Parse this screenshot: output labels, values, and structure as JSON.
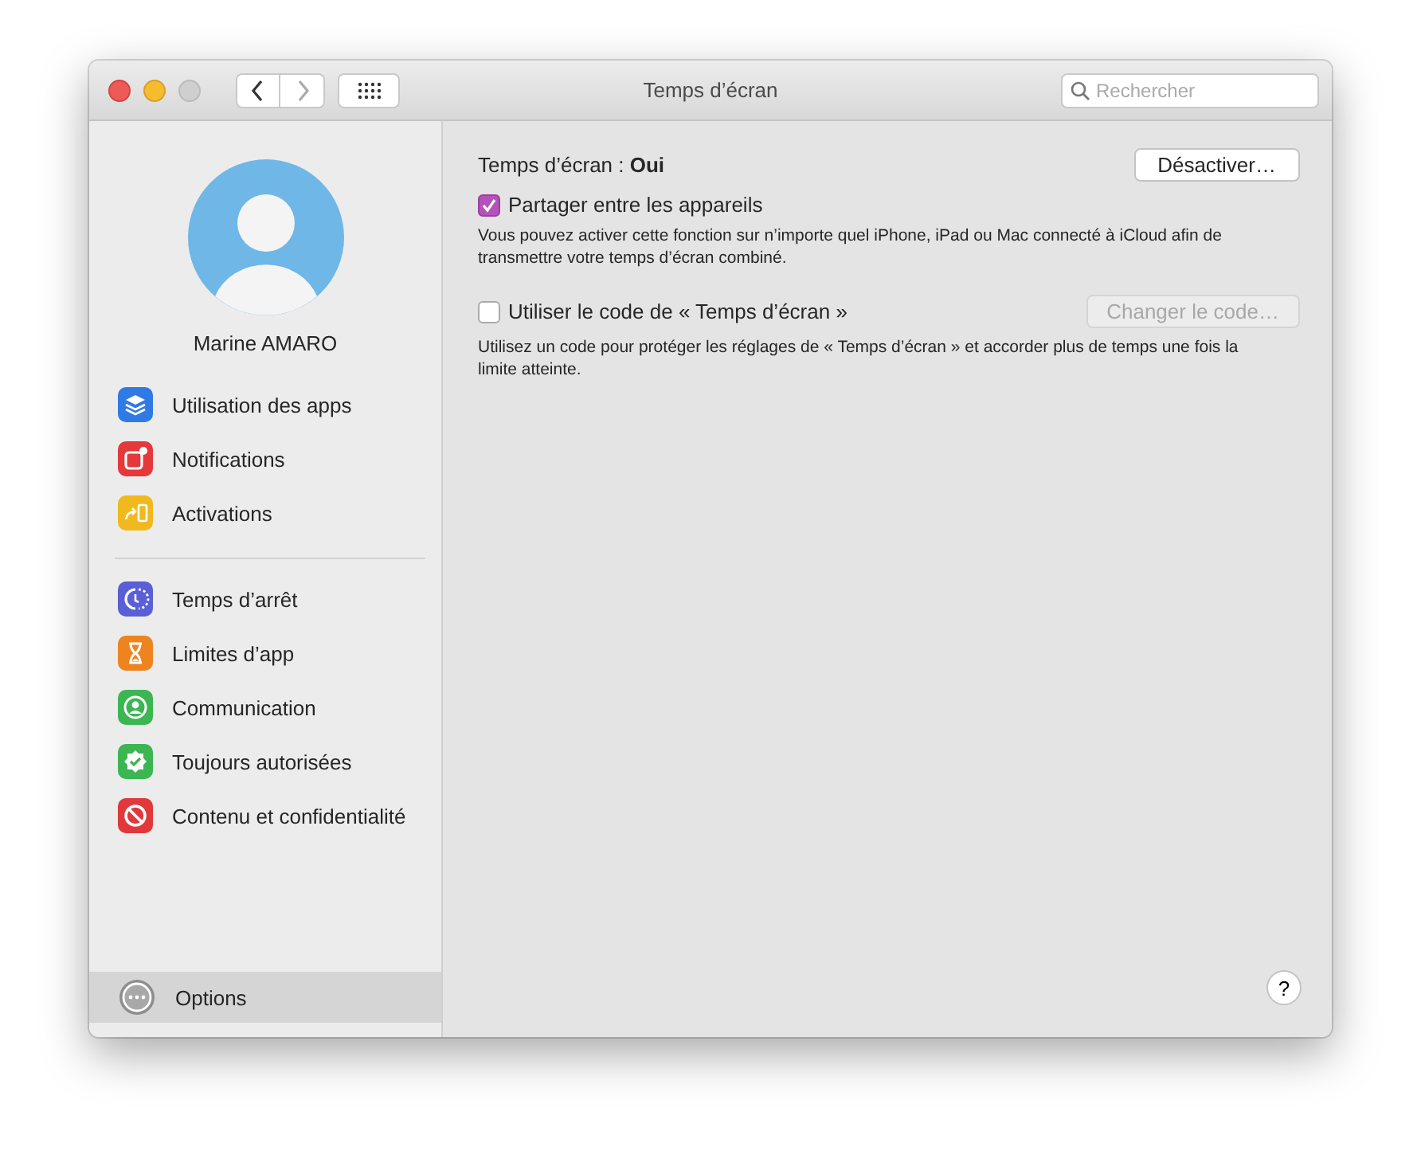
{
  "window": {
    "title": "Temps d’écran"
  },
  "search": {
    "placeholder": "Rechercher"
  },
  "user": {
    "name": "Marine AMARO"
  },
  "sidebar": {
    "groups": [
      {
        "items": [
          {
            "label": "Utilisation des apps",
            "kind": "layers",
            "color": "#2f7ae5",
            "selected": false
          },
          {
            "label": "Notifications",
            "kind": "notification",
            "color": "#e5383b",
            "selected": false
          },
          {
            "label": "Activations",
            "kind": "pickup",
            "color": "#f0b91e",
            "selected": false
          }
        ]
      },
      {
        "items": [
          {
            "label": "Temps d’arrêt",
            "kind": "downtime",
            "color": "#5a5fd6",
            "selected": false
          },
          {
            "label": "Limites d’app",
            "kind": "hourglass",
            "color": "#ee8420",
            "selected": false
          },
          {
            "label": "Communication",
            "kind": "person",
            "color": "#3cb653",
            "selected": false
          },
          {
            "label": "Toujours autorisées",
            "kind": "check",
            "color": "#3cb653",
            "selected": false
          },
          {
            "label": "Contenu et confidentialité",
            "kind": "block",
            "color": "#e0383b",
            "selected": false
          }
        ]
      }
    ],
    "footer": {
      "label": "Options",
      "selected": true
    }
  },
  "main": {
    "status": "Temps d’écran : **Oui**",
    "status_button": "Désactiver…",
    "options": [
      {
        "label": "Partager entre les appareils",
        "checked": true,
        "description": "Vous pouvez activer cette fonction sur n’importe quel iPhone, iPad ou Mac connecté à iCloud afin de transmettre votre temps d’écran combiné."
      },
      {
        "label": "Utiliser le code de « Temps d’écran »",
        "checked": false,
        "button": {
          "label": "Changer le code…",
          "disabled": true
        },
        "description": "Utilisez un code pour protéger les réglages de « Temps d’écran » et accorder plus de temps une fois la limite atteinte."
      }
    ],
    "help": "?"
  }
}
